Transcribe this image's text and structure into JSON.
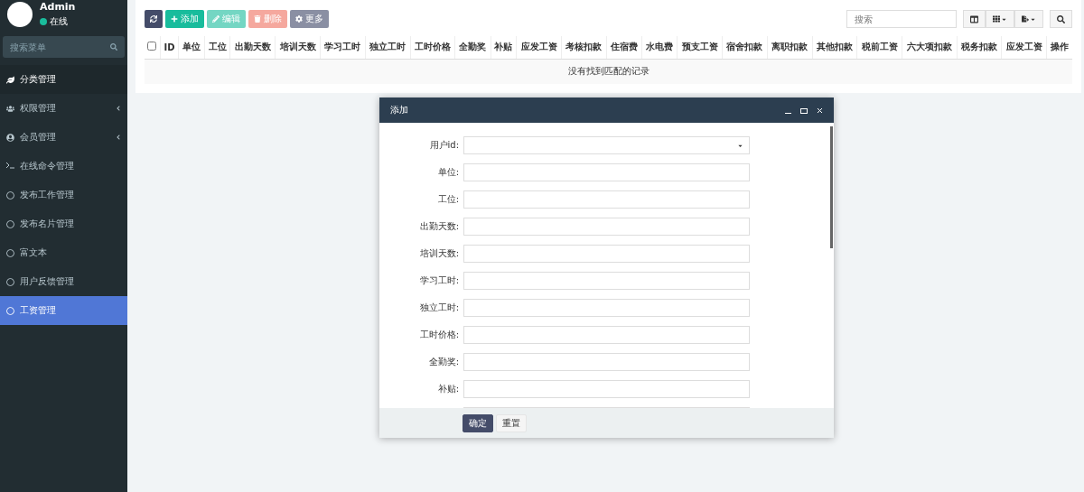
{
  "user": {
    "name": "Admin",
    "status": "在线"
  },
  "sidebar": {
    "search": {
      "placeholder": "搜索菜单"
    },
    "items": [
      {
        "label": "分类管理",
        "kind": "leaf",
        "submenu": false,
        "hovered": true,
        "selected": false
      },
      {
        "label": "权限管理",
        "kind": "group",
        "submenu": true,
        "hovered": false,
        "selected": false
      },
      {
        "label": "会员管理",
        "kind": "user",
        "submenu": true,
        "hovered": false,
        "selected": false
      },
      {
        "label": "在线命令管理",
        "kind": "terminal",
        "submenu": false,
        "hovered": false,
        "selected": false
      },
      {
        "label": "发布工作管理",
        "kind": "circle",
        "submenu": false,
        "hovered": false,
        "selected": false
      },
      {
        "label": "发布名片管理",
        "kind": "circle",
        "submenu": false,
        "hovered": false,
        "selected": false
      },
      {
        "label": "富文本",
        "kind": "circle",
        "submenu": false,
        "hovered": false,
        "selected": false
      },
      {
        "label": "用户反馈管理",
        "kind": "circle",
        "submenu": false,
        "hovered": false,
        "selected": false
      },
      {
        "label": "工资管理",
        "kind": "circle",
        "submenu": false,
        "hovered": false,
        "selected": true
      }
    ]
  },
  "toolbar": {
    "buttons": [
      {
        "kind": "refresh",
        "disabled": false
      },
      {
        "kind": "add",
        "label": "添加",
        "disabled": false
      },
      {
        "kind": "edit",
        "label": "编辑",
        "disabled": true
      },
      {
        "kind": "delete",
        "label": "删除",
        "disabled": true
      },
      {
        "kind": "more",
        "label": "更多",
        "disabled": false
      }
    ],
    "search": {
      "placeholder": "搜索"
    }
  },
  "table": {
    "columns": [
      "ID",
      "单位",
      "工位",
      "出勤天数",
      "培训天数",
      "学习工时",
      "独立工时",
      "工时价格",
      "全勤奖",
      "补贴",
      "应发工资",
      "考核扣款",
      "住宿费",
      "水电费",
      "预支工资",
      "宿舍扣款",
      "离职扣款",
      "其他扣款",
      "税前工资",
      "六大项扣款",
      "税务扣款",
      "应发工资",
      "操作"
    ],
    "select_all": {
      "checked": false
    },
    "empty_message": "没有找到匹配的记录"
  },
  "dialog": {
    "title": "添加",
    "fields": [
      {
        "label": "用户id:",
        "kind": "select"
      },
      {
        "label": "单位:",
        "kind": "text"
      },
      {
        "label": "工位:",
        "kind": "text"
      },
      {
        "label": "出勤天数:",
        "kind": "text"
      },
      {
        "label": "培训天数:",
        "kind": "text"
      },
      {
        "label": "学习工时:",
        "kind": "text"
      },
      {
        "label": "独立工时:",
        "kind": "text"
      },
      {
        "label": "工时价格:",
        "kind": "text"
      },
      {
        "label": "全勤奖:",
        "kind": "text"
      },
      {
        "label": "补贴:",
        "kind": "text"
      },
      {
        "kind": "text"
      }
    ],
    "buttons": [
      {
        "label": "确定",
        "kind": "primary"
      },
      {
        "label": "重置",
        "kind": "default"
      }
    ]
  }
}
